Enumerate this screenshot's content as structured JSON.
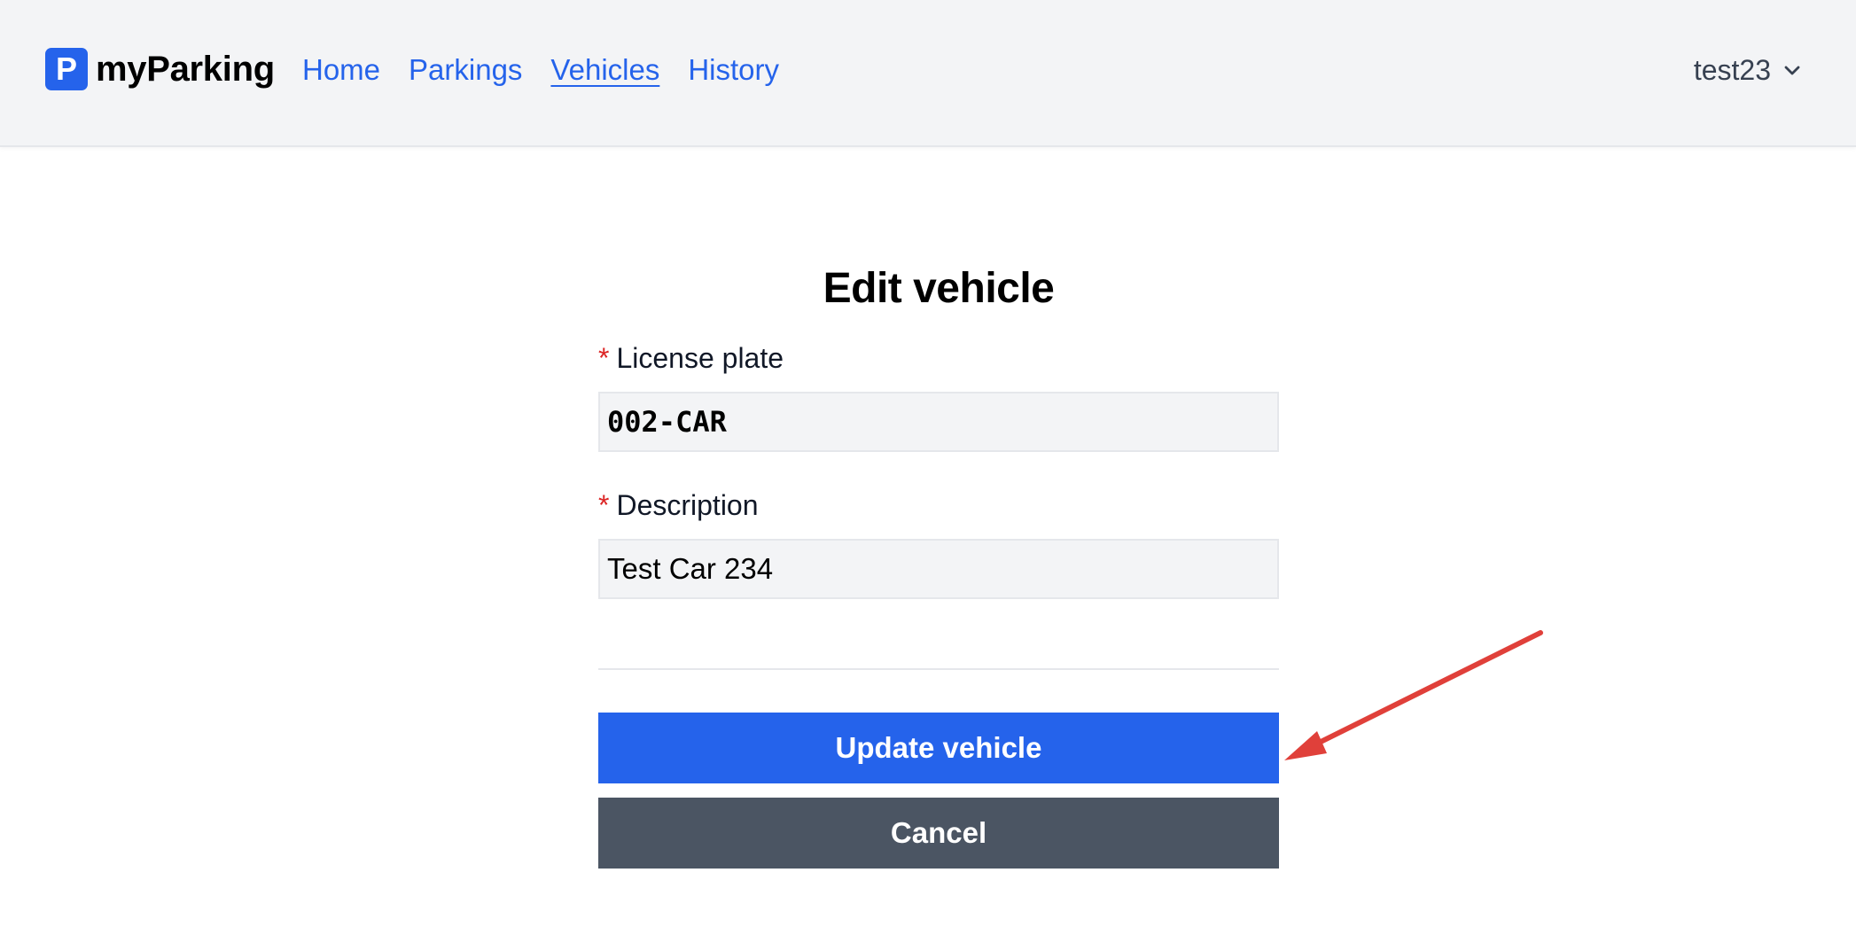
{
  "brand": {
    "logo_letter": "P",
    "name": "myParking"
  },
  "nav": {
    "links": [
      {
        "label": "Home"
      },
      {
        "label": "Parkings"
      },
      {
        "label": "Vehicles",
        "active": true
      },
      {
        "label": "History"
      }
    ]
  },
  "user_menu": {
    "username": "test23",
    "icon": "chevron-down-icon"
  },
  "form": {
    "title": "Edit vehicle",
    "required_marker": "*",
    "license_plate": {
      "label": "License plate",
      "value": "002-CAR"
    },
    "description": {
      "label": "Description",
      "value": "Test Car 234"
    },
    "submit_label": "Update vehicle",
    "cancel_label": "Cancel"
  },
  "colors": {
    "accent": "#2563eb",
    "secondary_button": "#4b5563",
    "navbar_bg": "#f3f4f6",
    "required": "#dc2626",
    "annotation_arrow": "#e0403a"
  }
}
